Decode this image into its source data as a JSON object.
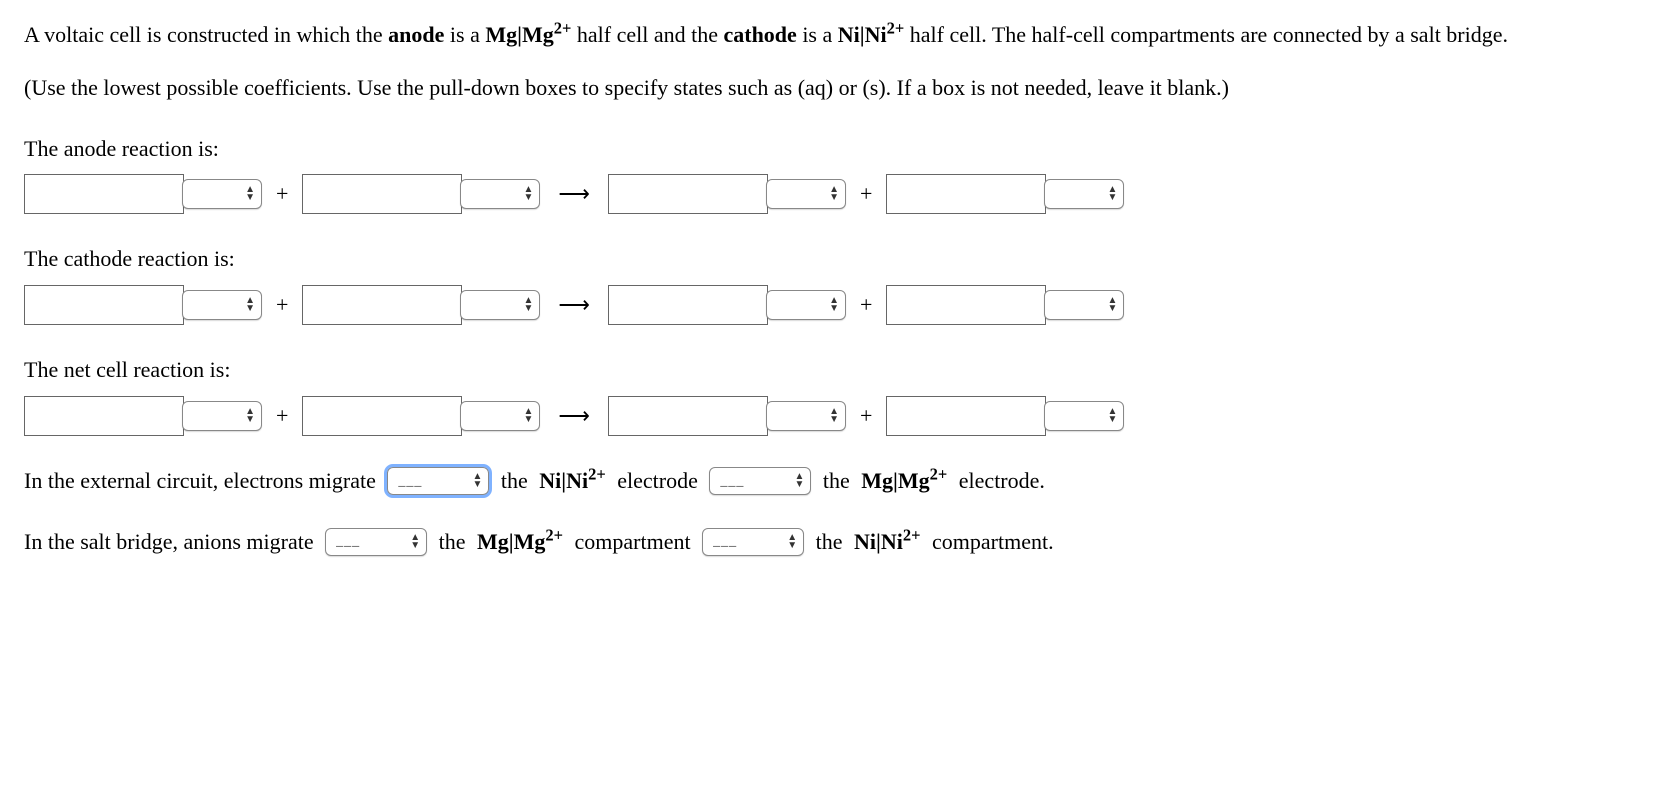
{
  "intro": {
    "part1": "A voltaic cell is constructed in which the ",
    "anode_word": "anode",
    "part2": " is a ",
    "half1_pre": "Mg|Mg",
    "half1_sup": "2+",
    "part3": " half cell and the ",
    "cathode_word": "cathode",
    "part4": " is a ",
    "half2_pre": "Ni|Ni",
    "half2_sup": "2+",
    "part5": " half cell. The half-cell compartments are connected by a salt bridge."
  },
  "instruction": "(Use the lowest possible coefficients. Use the pull-down boxes to specify states such as (aq) or (s). If a box is not needed, leave it blank.)",
  "labels": {
    "anode": "The anode reaction is:",
    "cathode": "The cathode reaction is:",
    "net": "The net cell reaction is:"
  },
  "ops": {
    "plus": "+",
    "arrow": "⟶"
  },
  "select_placeholder": "___",
  "sentence1": {
    "t1": "In the external circuit, electrons migrate ",
    "t2": " the ",
    "e1_pre": "Ni|Ni",
    "e1_sup": "2+",
    "t3": " electrode ",
    "t4": " the ",
    "e2_pre": "Mg|Mg",
    "e2_sup": "2+",
    "t5": " electrode."
  },
  "sentence2": {
    "t1": "In the salt bridge, anions migrate ",
    "t2": " the ",
    "e1_pre": "Mg|Mg",
    "e1_sup": "2+",
    "t3": " compartment ",
    "t4": " the ",
    "e2_pre": "Ni|Ni",
    "e2_sup": "2+",
    "t5": " compartment."
  }
}
